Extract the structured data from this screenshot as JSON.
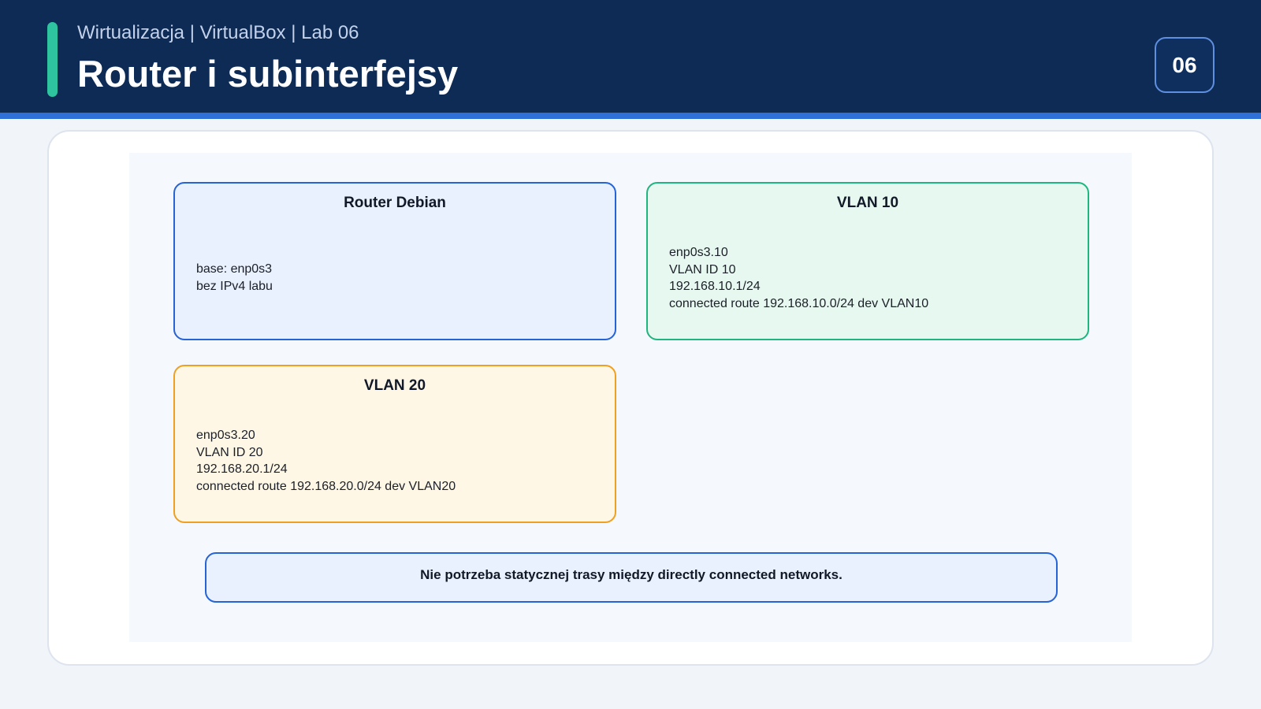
{
  "header": {
    "subtitle": "Wirtualizacja | VirtualBox | Lab 06",
    "title": "Router i subinterfejsy",
    "slide_number": "06"
  },
  "diagram": {
    "router": {
      "title": "Router Debian",
      "lines": [
        "base: enp0s3",
        "bez IPv4 labu"
      ]
    },
    "vlan10": {
      "title": "VLAN 10",
      "lines": [
        "enp0s3.10",
        "VLAN ID 10",
        "192.168.10.1/24",
        "connected route 192.168.10.0/24 dev VLAN10"
      ]
    },
    "vlan20": {
      "title": "VLAN 20",
      "lines": [
        "enp0s3.20",
        "VLAN ID 20",
        "192.168.20.1/24",
        "connected route 192.168.20.0/24 dev VLAN20"
      ]
    },
    "note": "Nie potrzeba statycznej trasy między directly connected networks."
  },
  "colors": {
    "header_bg": "#0d2b55",
    "accent": "#2ec4a0",
    "router_border": "#2563d6",
    "vlan10_border": "#1fb57e",
    "vlan20_border": "#f0a020"
  }
}
